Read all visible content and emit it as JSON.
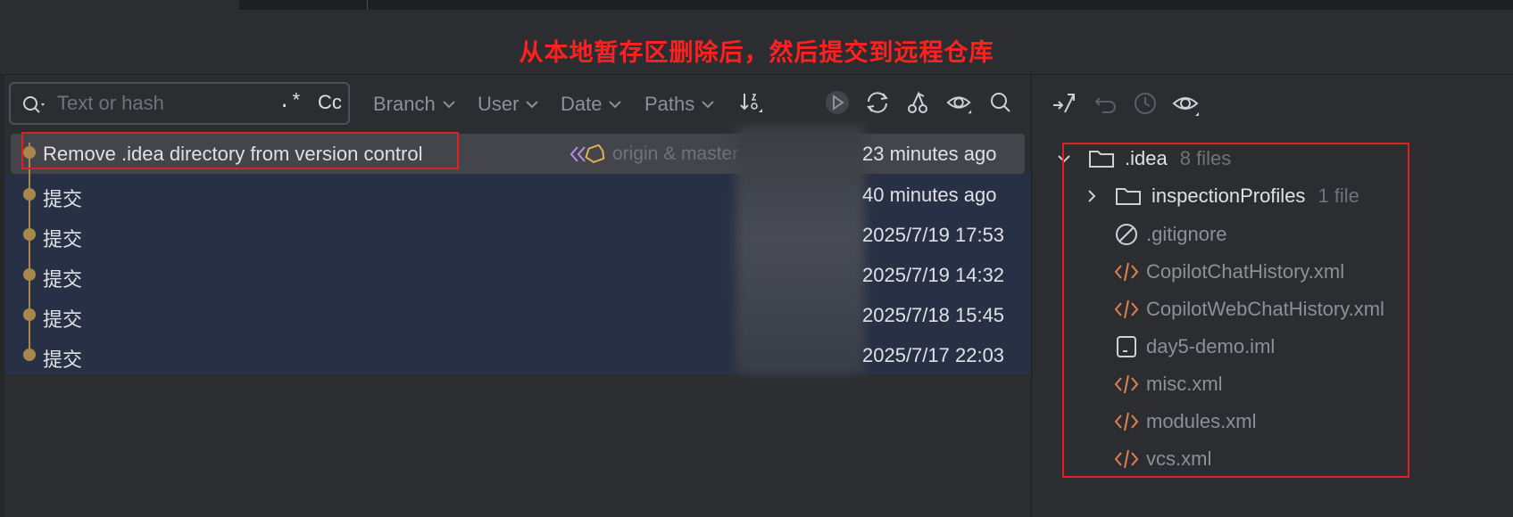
{
  "annotation": {
    "banner": "从本地暂存区删除后，然后提交到远程仓库"
  },
  "search": {
    "placeholder": "Text or hash",
    "regex_label": ".*",
    "case_label": "Cc"
  },
  "filters": {
    "branch": "Branch",
    "user": "User",
    "date": "Date",
    "paths": "Paths"
  },
  "toolbar_icons": [
    "sort-icon",
    "run-icon",
    "refresh-icon",
    "cherry-pick-icon",
    "eye-icon",
    "search-icon"
  ],
  "commits": [
    {
      "message": "Remove .idea directory from version control",
      "refs": "origin & master",
      "time": "23 minutes ago",
      "selected": true
    },
    {
      "message": "提交",
      "time": "40 minutes ago"
    },
    {
      "message": "提交",
      "time": "2025/7/19 17:53"
    },
    {
      "message": "提交",
      "time": "2025/7/19 14:32"
    },
    {
      "message": "提交",
      "time": "2025/7/18 15:45"
    },
    {
      "message": "提交",
      "time": "2025/7/17 22:03"
    }
  ],
  "changes_tree": {
    "root": {
      "name": ".idea",
      "count": "8 files"
    },
    "folder": {
      "name": "inspectionProfiles",
      "count": "1 file"
    },
    "files": [
      {
        "name": ".gitignore",
        "icon": "ignore-icon"
      },
      {
        "name": "CopilotChatHistory.xml",
        "icon": "xml-icon"
      },
      {
        "name": "CopilotWebChatHistory.xml",
        "icon": "xml-icon"
      },
      {
        "name": "day5-demo.iml",
        "icon": "module-icon"
      },
      {
        "name": "misc.xml",
        "icon": "xml-icon"
      },
      {
        "name": "modules.xml",
        "icon": "xml-icon"
      },
      {
        "name": "vcs.xml",
        "icon": "xml-icon"
      }
    ]
  },
  "colors": {
    "annotation_red": "#e02020",
    "graph_node": "#a8874a",
    "xml_icon": "#e0814e"
  }
}
